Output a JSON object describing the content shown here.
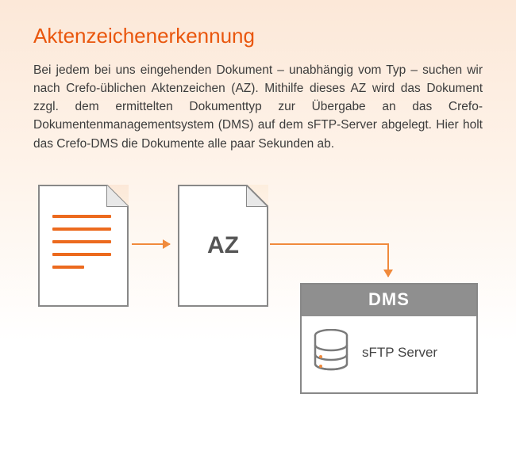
{
  "title": "Aktenzeichenerkennung",
  "body": "Bei jedem bei uns eingehenden Dokument – unabhängig vom Typ – suchen wir nach Crefo-üblichen Aktenzeichen (AZ). Mithilfe dieses AZ wird das Dokument zzgl. dem ermittelten Dokumenttyp zur Übergabe an das Crefo-Dokumentenmanagementsystem (DMS) auf dem sFTP-Server abgelegt. Hier holt das Crefo-DMS die Dokumente alle paar Sekunden ab.",
  "diagram": {
    "doc1_label": "",
    "doc2_label": "AZ",
    "dms_header": "DMS",
    "sftp_label": "sFTP Server"
  },
  "colors": {
    "accent": "#e9560d",
    "arrow": "#f08a3c",
    "border": "#888888"
  }
}
